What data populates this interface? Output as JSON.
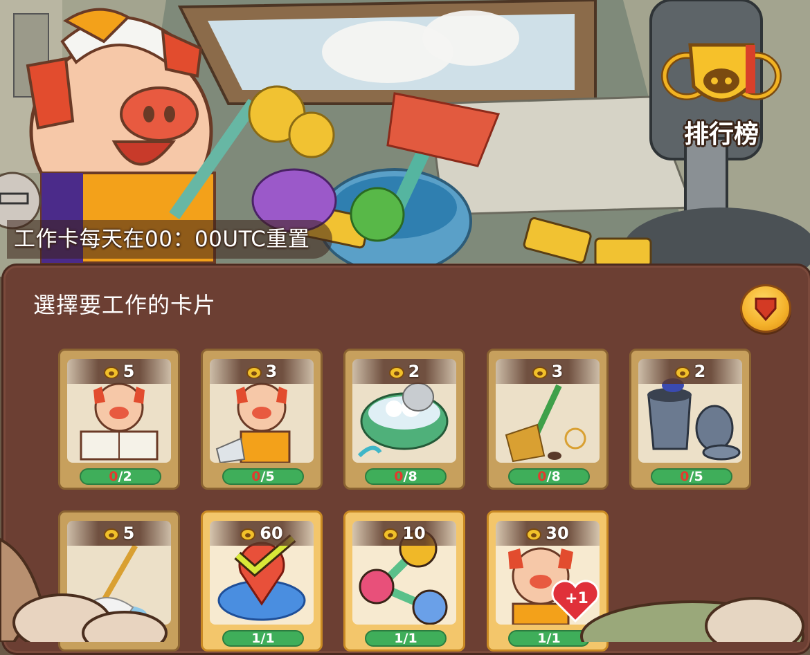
{
  "scene": {
    "reset_notice": "工作卡每天在00：00UTC重置",
    "leaderboard_label": "排行榜"
  },
  "panel": {
    "title": "選擇要工作的卡片"
  },
  "cards": [
    {
      "cost": "5",
      "current": "0",
      "total": "/2",
      "art": "pig-reading-icon"
    },
    {
      "cost": "3",
      "current": "0",
      "total": "/5",
      "art": "pig-cleaning-icon"
    },
    {
      "cost": "2",
      "current": "0",
      "total": "/8",
      "art": "wash-basin-icon"
    },
    {
      "cost": "3",
      "current": "0",
      "total": "/8",
      "art": "broom-icon"
    },
    {
      "cost": "2",
      "current": "0",
      "total": "/5",
      "art": "trash-can-icon"
    },
    {
      "cost": "5",
      "current": "",
      "total": "",
      "art": "mop-icon"
    },
    {
      "cost": "60",
      "current": "",
      "total": "1/1",
      "art": "location-check-icon"
    },
    {
      "cost": "10",
      "current": "",
      "total": "1/1",
      "art": "share-icon"
    },
    {
      "cost": "30",
      "current": "",
      "total": "1/1",
      "art": "pig-heart-plus-one-icon",
      "badge": "+1"
    }
  ],
  "colors": {
    "panel": "#6c3f33",
    "card": "#c7a05d",
    "card_gold": "#f3c66b",
    "progress": "#3fae5a",
    "progress_current": "#e23b2e"
  }
}
